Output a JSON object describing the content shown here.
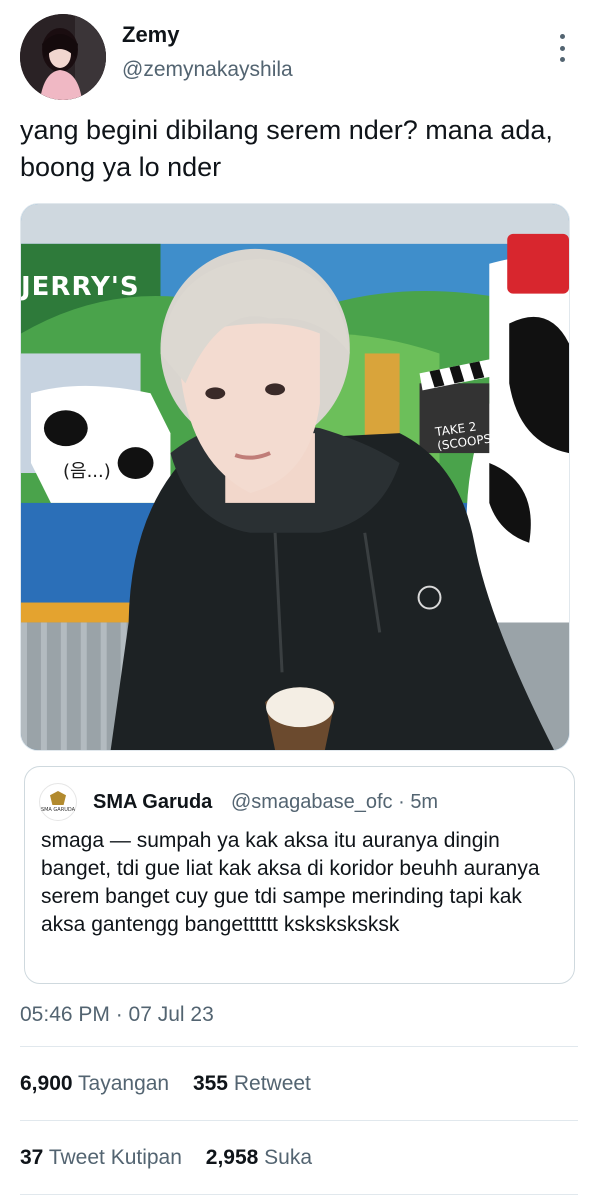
{
  "author": {
    "name": "Zemy",
    "handle": "@zemynakayshila"
  },
  "tweet": {
    "text": "yang begini dibilang serem nder? mana ada, boong ya lo nder"
  },
  "photo": {
    "sign_text": "JERRY'S",
    "sticker_text": "(음...)",
    "board_text": "TAKE 2\n(SCOOPS)"
  },
  "quoted_tweet": {
    "name": "SMA Garuda",
    "handle": "@smagabase_ofc",
    "separator": "·",
    "age": "5m",
    "avatar_text": "SMA GARUDA",
    "text": "smaga — sumpah ya kak aksa itu auranya dingin banget, tdi gue liat kak aksa di koridor beuhh auranya serem banget cuy gue tdi sampe merinding tapi kak aksa gantengg bangetttttt ksksksksksk"
  },
  "timestamp": "05:46 PM · 07 Jul 23",
  "stats_row1": {
    "views_count": "6,900",
    "views_label": "Tayangan",
    "retweets_count": "355",
    "retweets_label": "Retweet"
  },
  "stats_row2": {
    "quotes_count": "37",
    "quotes_label": "Tweet Kutipan",
    "likes_count": "2,958",
    "likes_label": "Suka"
  },
  "colors": {
    "text_primary": "#0f1419",
    "text_secondary": "#536471",
    "border": "#cfd9de"
  }
}
